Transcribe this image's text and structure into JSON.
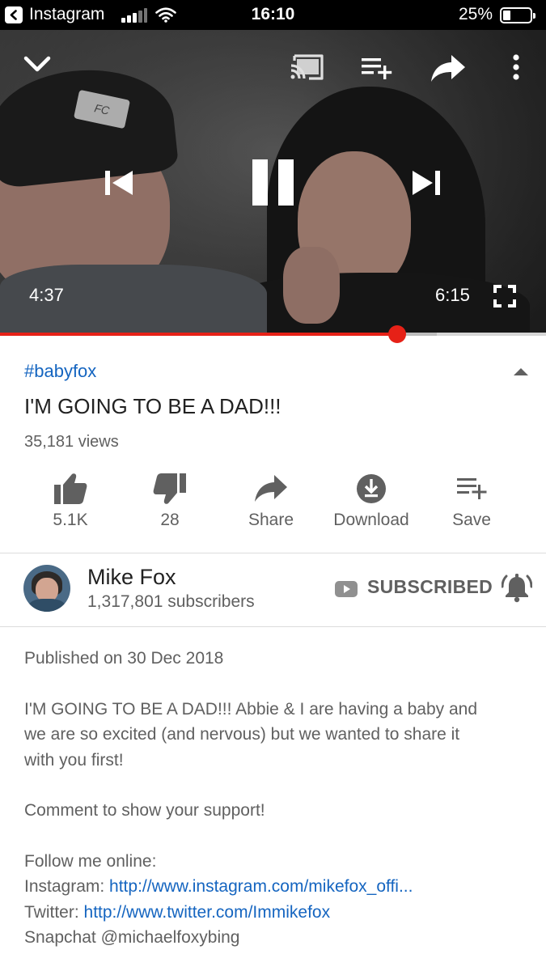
{
  "status_bar": {
    "app": "Instagram",
    "time": "16:10",
    "battery": "25%",
    "battery_level": 0.25
  },
  "player": {
    "current_time": "4:37",
    "duration": "6:15",
    "progress_fraction": 0.727,
    "buffered_fraction": 0.8,
    "icons": [
      "chevron-down-icon",
      "cast-icon",
      "add-to-queue-icon",
      "share-icon",
      "more-vert-icon",
      "previous-icon",
      "pause-icon",
      "next-icon",
      "fullscreen-icon"
    ],
    "beanie_text": "FC"
  },
  "video": {
    "hashtag": "#babyfox",
    "title": "I'M GOING TO BE A DAD!!!",
    "views": "35,181 views"
  },
  "actions": [
    {
      "label": "5.1K",
      "icon": "thumbs-up-icon"
    },
    {
      "label": "28",
      "icon": "thumbs-down-icon"
    },
    {
      "label": "Share",
      "icon": "share-icon"
    },
    {
      "label": "Download",
      "icon": "download-icon"
    },
    {
      "label": "Save",
      "icon": "add-to-playlist-icon"
    }
  ],
  "channel": {
    "name": "Mike Fox",
    "subscribers": "1,317,801 subscribers",
    "subscribe_label": "SUBSCRIBED"
  },
  "description": {
    "published": "Published on 30 Dec 2018",
    "body_line1": "I'M GOING TO BE A DAD!!! Abbie & I are having a baby and",
    "body_line2": "we are so excited (and nervous) but we wanted to share it",
    "body_line3": "with you first!",
    "support": "Comment to show your support!",
    "follow": "Follow me online:",
    "instagram_label": "Instagram: ",
    "instagram_url": "http://www.instagram.com/mikefox_offi...",
    "twitter_label": "Twitter: ",
    "twitter_url": "http://www.twitter.com/Immikefox",
    "snapchat": "Snapchat @michaelfoxybing"
  },
  "colors": {
    "accent_red": "#e62117",
    "link_blue": "#1565c0",
    "secondary_text": "#606060"
  }
}
